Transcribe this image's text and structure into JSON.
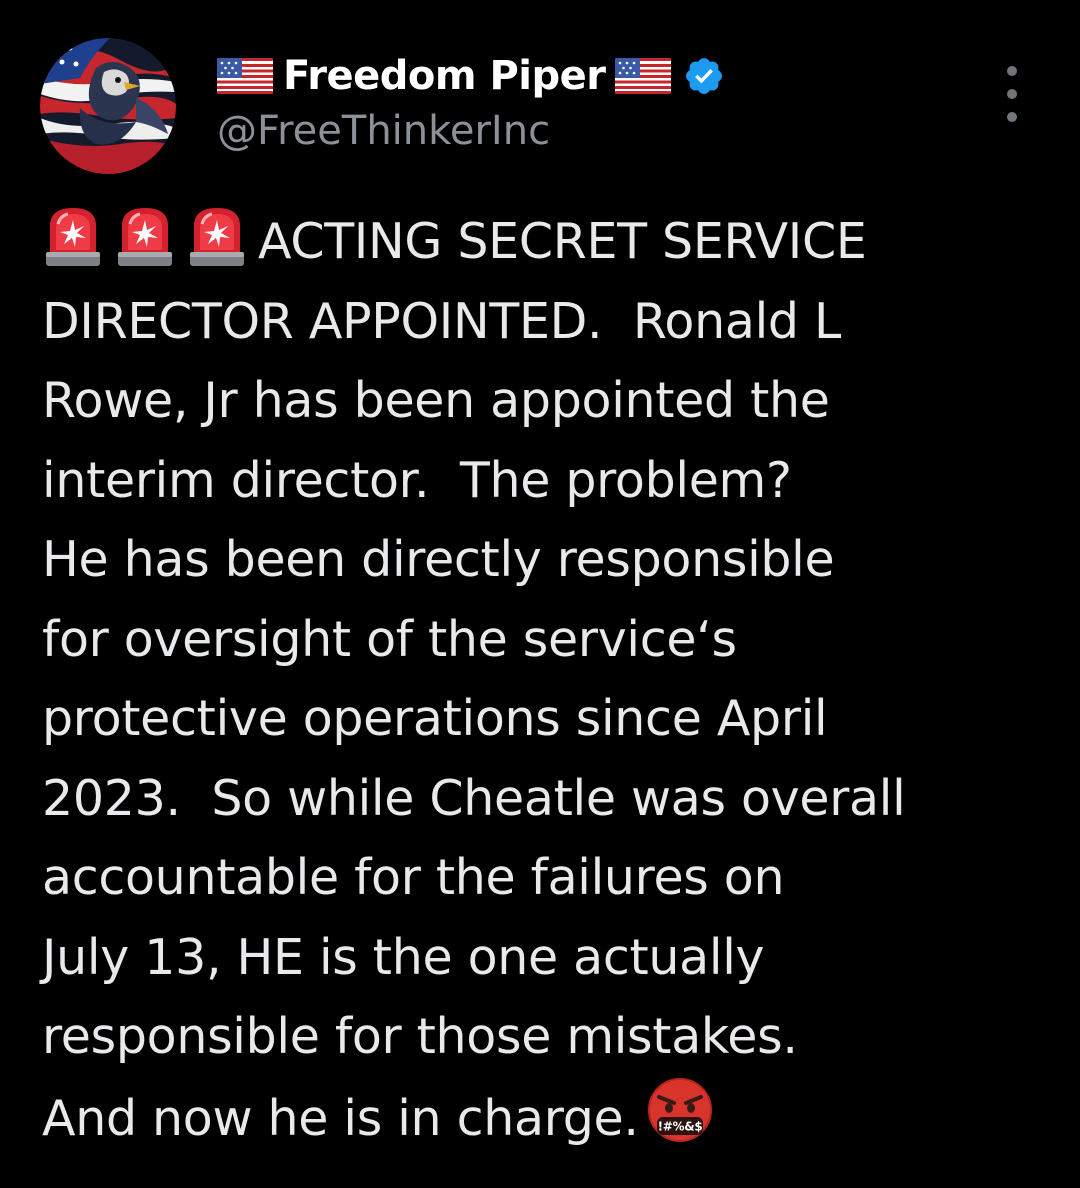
{
  "author": {
    "display_name": "Freedom Piper",
    "handle": "@FreeThinkerInc",
    "verified": true,
    "verified_color": "#1d9bf0",
    "name_prefix_icon": "us-flag-icon",
    "name_suffix_icon": "us-flag-icon",
    "avatar_icon": "patriotic-eagle-avatar"
  },
  "menu": {
    "icon": "more-options-icon"
  },
  "tweet": {
    "leading_emoji": [
      "police-siren-icon",
      "police-siren-icon",
      "police-siren-icon"
    ],
    "lines": [
      "ACTING SECRET SERVICE",
      "DIRECTOR APPOINTED.  Ronald L",
      "Rowe, Jr has been appointed the",
      "interim director.  The problem?",
      "He has been directly responsible",
      "for oversight of the service‘s",
      "protective operations since April",
      "2023.  So while Cheatle was overall",
      "accountable for the failures on",
      "July 13, HE is the one actually",
      "responsible for those mistakes.",
      "And now he is in charge."
    ],
    "trailing_emoji": "face-with-symbols-on-mouth-icon",
    "trailing_emoji_symbols": "!#%&$"
  }
}
